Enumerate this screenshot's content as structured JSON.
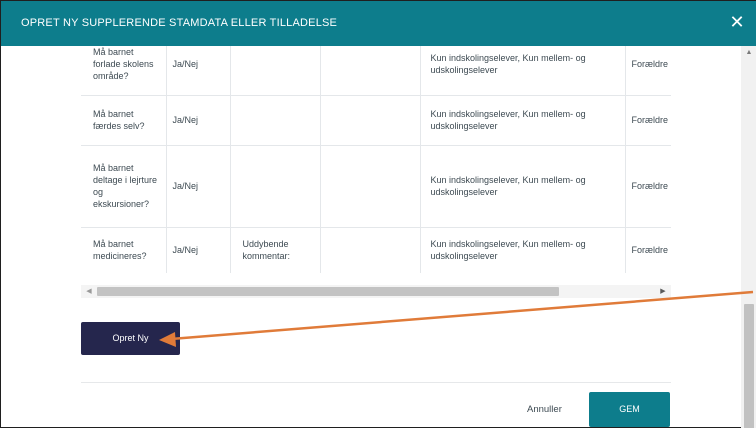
{
  "dialog": {
    "title": "OPRET NY SUPPLERENDE STAMDATA ELLER TILLADELSE",
    "close_glyph": "✕"
  },
  "table": {
    "rows": [
      {
        "question": "Må barnet forlade skolens område?",
        "type": "Ja/Nej",
        "comment": "",
        "extra": "",
        "groups": "Kun indskolingselever, Kun mellem- og udskolingselever",
        "responder": "Forældre"
      },
      {
        "question": "Må barnet færdes selv?",
        "type": "Ja/Nej",
        "comment": "",
        "extra": "",
        "groups": "Kun indskolingselever, Kun mellem- og udskolingselever",
        "responder": "Forældre"
      },
      {
        "question": "Må barnet deltage i lejrture og ekskursioner?",
        "type": "Ja/Nej",
        "comment": "",
        "extra": "",
        "groups": "Kun indskolingselever, Kun mellem- og udskolingselever",
        "responder": "Forældre"
      },
      {
        "question": "Må barnet medicineres?",
        "type": "Ja/Nej",
        "comment": "Uddybende kommentar:",
        "extra": "",
        "groups": "Kun indskolingselever, Kun mellem- og udskolingselever",
        "responder": "Forældre"
      }
    ]
  },
  "actions": {
    "create_new": "Opret Ny",
    "cancel": "Annuller",
    "save": "GEM"
  },
  "scroll": {
    "left_arrow": "◀",
    "right_arrow": "▶",
    "up_arrow": "▲"
  },
  "annotation": {
    "arrow_color": "#e07b39"
  }
}
